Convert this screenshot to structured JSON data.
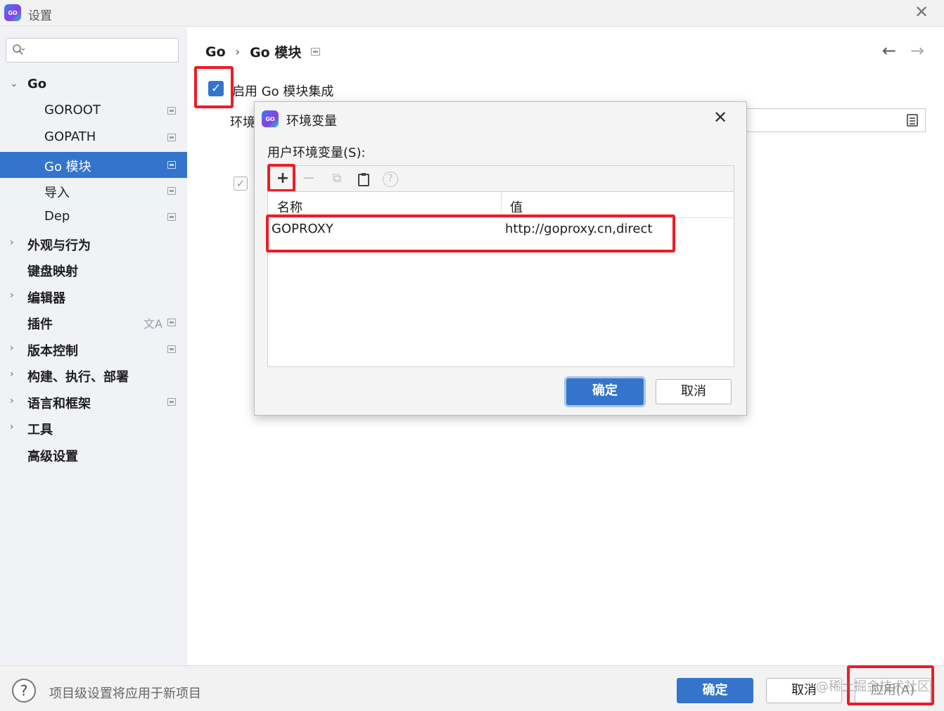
{
  "window": {
    "title": "设置",
    "close_glyph": "✕",
    "app_icon_text": "GO"
  },
  "sidebar": {
    "search_placeholder": "",
    "items": [
      {
        "label": "Go",
        "expanded": true
      },
      {
        "label": "GOROOT"
      },
      {
        "label": "GOPATH"
      },
      {
        "label": "Go 模块",
        "selected": true
      },
      {
        "label": "导入"
      },
      {
        "label": "Dep"
      },
      {
        "label": "外观与行为"
      },
      {
        "label": "键盘映射"
      },
      {
        "label": "编辑器"
      },
      {
        "label": "插件"
      },
      {
        "label": "版本控制"
      },
      {
        "label": "构建、执行、部署"
      },
      {
        "label": "语言和框架"
      },
      {
        "label": "工具"
      },
      {
        "label": "高级设置"
      }
    ]
  },
  "main": {
    "breadcrumb": {
      "parent": "Go",
      "separator": "›",
      "current": "Go 模块"
    },
    "nav": {
      "back": "←",
      "forward": "→"
    },
    "enable_module_label": "启用 Go 模块集成",
    "enable_module_checked": true,
    "env_label": "环境",
    "second_checkbox_checked": true
  },
  "dialog": {
    "title": "环境变量",
    "close_glyph": "✕",
    "subtitle": "用户环境变量(S):",
    "toolbar": {
      "add": "+",
      "remove": "−",
      "copy": "⧉",
      "paste": "📋",
      "help": "?"
    },
    "table": {
      "columns": [
        "名称",
        "值"
      ],
      "rows": [
        {
          "name": "GOPROXY",
          "value": "http://goproxy.cn,direct"
        }
      ]
    },
    "ok_label": "确定",
    "cancel_label": "取消"
  },
  "bottom": {
    "help": "?",
    "status_text": "项目级设置将应用于新项目",
    "ok_label": "确定",
    "cancel_label": "取消",
    "apply_label": "应用(A)",
    "watermark": "@稀土掘金技术社区"
  },
  "colors": {
    "accent": "#3574cc",
    "highlight_box": "#ee1c25",
    "sidebar_bg": "#f0f2f5"
  }
}
